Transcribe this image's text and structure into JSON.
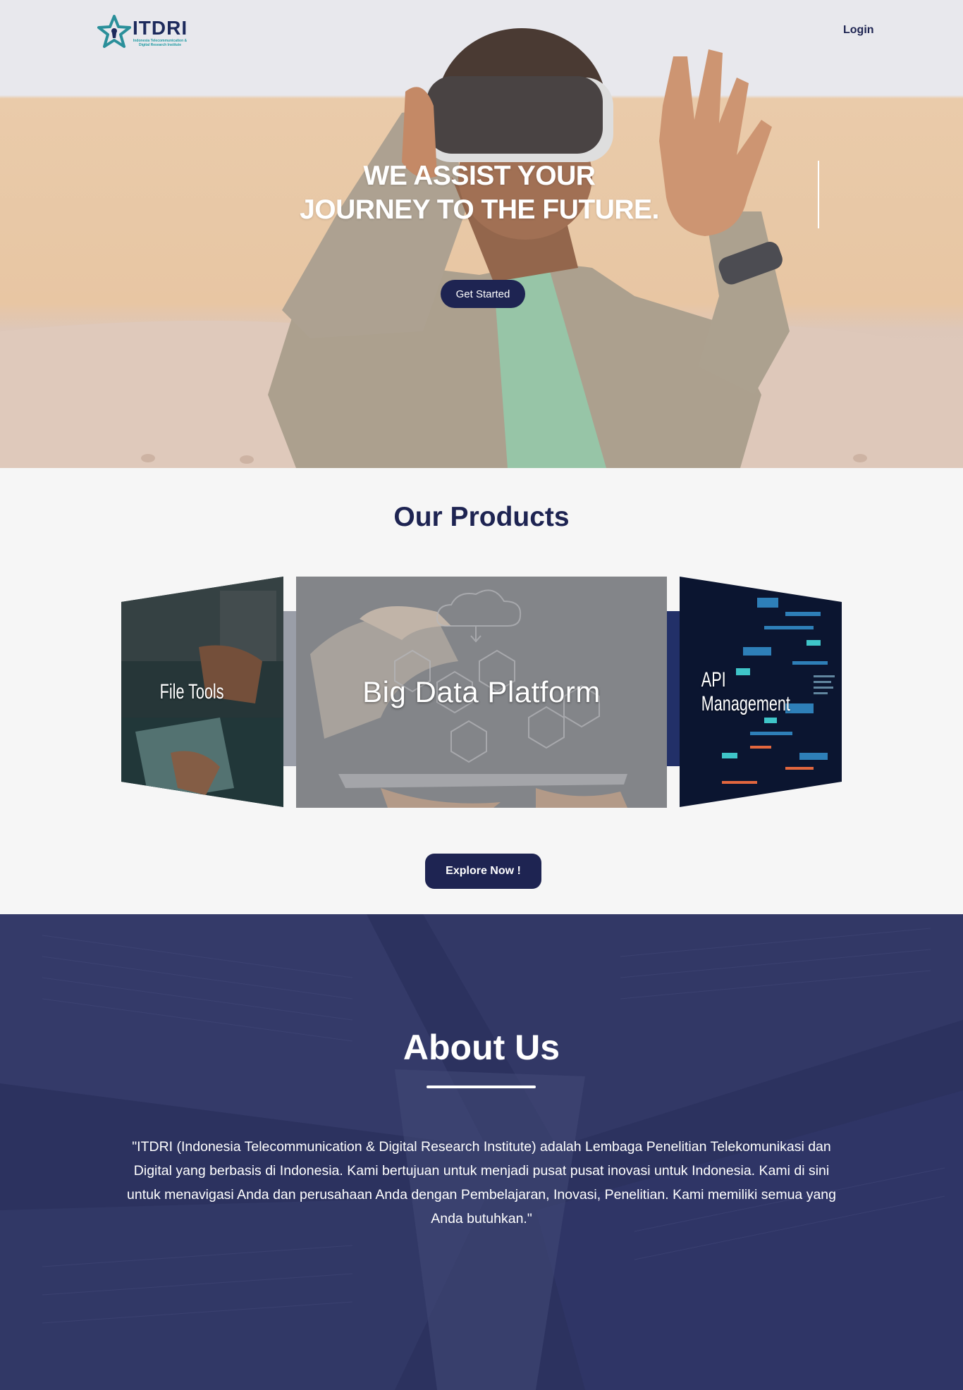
{
  "header": {
    "logo_text": "ITDRI",
    "logo_subtitle": "Indonesia Telecommunication & Digital Research Institute",
    "login_label": "Login"
  },
  "hero": {
    "title_line1": "WE ASSIST YOUR",
    "title_line2": "JOURNEY TO THE FUTURE.",
    "cta_label": "Get Started"
  },
  "products": {
    "title": "Our Products",
    "cards": [
      {
        "label": "File Tools"
      },
      {
        "label": "Big Data Platform"
      },
      {
        "label": "API Management"
      }
    ],
    "cta_label": "Explore Now !"
  },
  "about": {
    "title": "About Us",
    "text": "\"ITDRI (Indonesia Telecommunication & Digital Research Institute) adalah Lembaga Penelitian Telekomunikasi dan Digital yang berbasis di Indonesia. Kami bertujuan untuk menjadi pusat pusat inovasi untuk Indonesia. Kami di sini untuk menavigasi Anda dan perusahaan Anda dengan Pembelajaran, Inovasi, Penelitian. Kami memiliki semua yang Anda butuhkan.\""
  },
  "colors": {
    "navy": "#1e2452",
    "about_bg": "#2a2f5c",
    "logo_teal": "#1f9ba3"
  }
}
